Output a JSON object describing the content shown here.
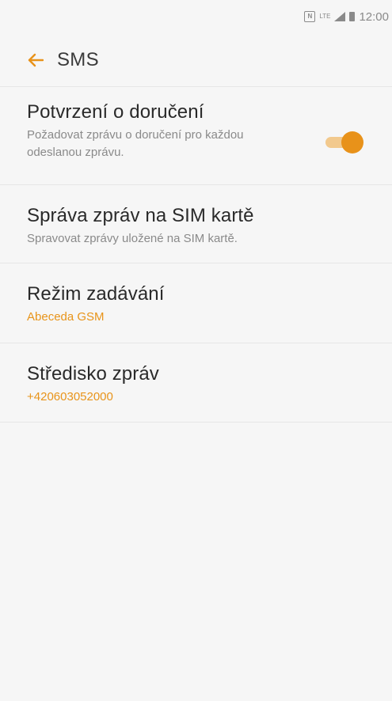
{
  "status_bar": {
    "time": "12:00",
    "icons": [
      "nfc-icon",
      "lte-icon",
      "signal-icon",
      "battery-icon"
    ],
    "lte_label": "LTE"
  },
  "app_bar": {
    "back_icon": "back-arrow-icon",
    "title": "SMS"
  },
  "settings": [
    {
      "title": "Potvrzení o doručení",
      "subtitle": "Požadovat zprávu o doručení pro každou odeslanou zprávu.",
      "toggle_on": true
    },
    {
      "title": "Správa zpráv na SIM kartě",
      "subtitle": "Spravovat zprávy uložené na SIM kartě."
    },
    {
      "title": "Režim zadávání",
      "subtitle": "Abeceda GSM"
    },
    {
      "title": "Středisko zpráv",
      "subtitle": "+420603052000"
    }
  ],
  "colors": {
    "accent": "#e8921a",
    "accent_light": "#f2c98d",
    "background": "#f6f6f6",
    "divider": "#e6e6e6",
    "text_primary": "#2a2a2a",
    "text_secondary": "#8a8a8a"
  }
}
